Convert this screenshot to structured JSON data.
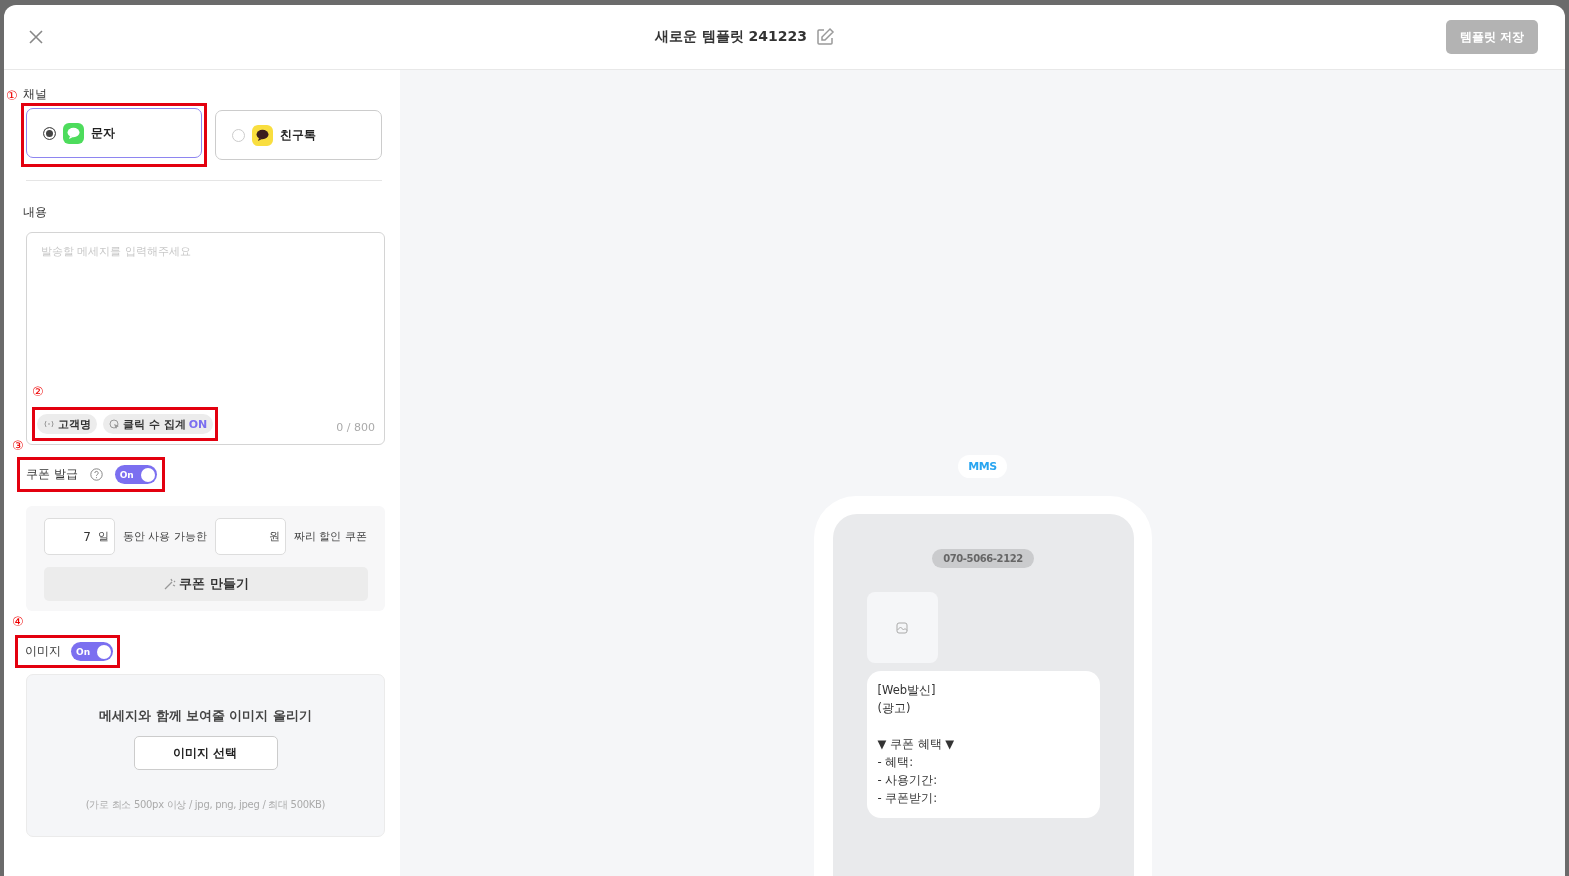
{
  "header": {
    "title": "새로운 템플릿 241223",
    "save_button": {
      "label": "템플릿 저장",
      "disabled": true
    }
  },
  "channel": {
    "marker": "①",
    "label": "채널",
    "options": [
      {
        "label": "문자",
        "kind": "sms",
        "selected": true
      },
      {
        "label": "친구톡",
        "kind": "kakao",
        "selected": false
      }
    ]
  },
  "content": {
    "label": "내용",
    "placeholder": "발송할 메세지를 입력해주세요",
    "marker": "②",
    "chips": [
      {
        "label": "고객명",
        "kind": "variable"
      },
      {
        "label": "클릭 수 집계",
        "status": "ON",
        "kind": "click"
      }
    ],
    "counter": "0 / 800"
  },
  "coupon": {
    "marker": "③",
    "label": "쿠폰 발급",
    "toggle": {
      "label": "On",
      "on": true
    },
    "days": "7",
    "day_unit": "일",
    "text_1": "동안 사용 가능한",
    "amount_unit": "원",
    "text_2": "짜리 할인 쿠폰",
    "button": "쿠폰 만들기"
  },
  "image": {
    "marker": "④",
    "label": "이미지",
    "toggle": {
      "label": "On",
      "on": true
    },
    "title": "메세지와 함께 보여줄 이미지 올리기",
    "button": "이미지 선택",
    "hint": "(가로 최소 500px 이상 / jpg, png, jpeg / 최대 500KB)"
  },
  "preview": {
    "type_badge": "MMS",
    "sender": "070-5066-2122",
    "message": "[Web발신]\n(광고)\n\n▼ 쿠폰 혜택 ▼\n- 혜택:\n- 사용기간:\n- 쿠폰받기:"
  }
}
